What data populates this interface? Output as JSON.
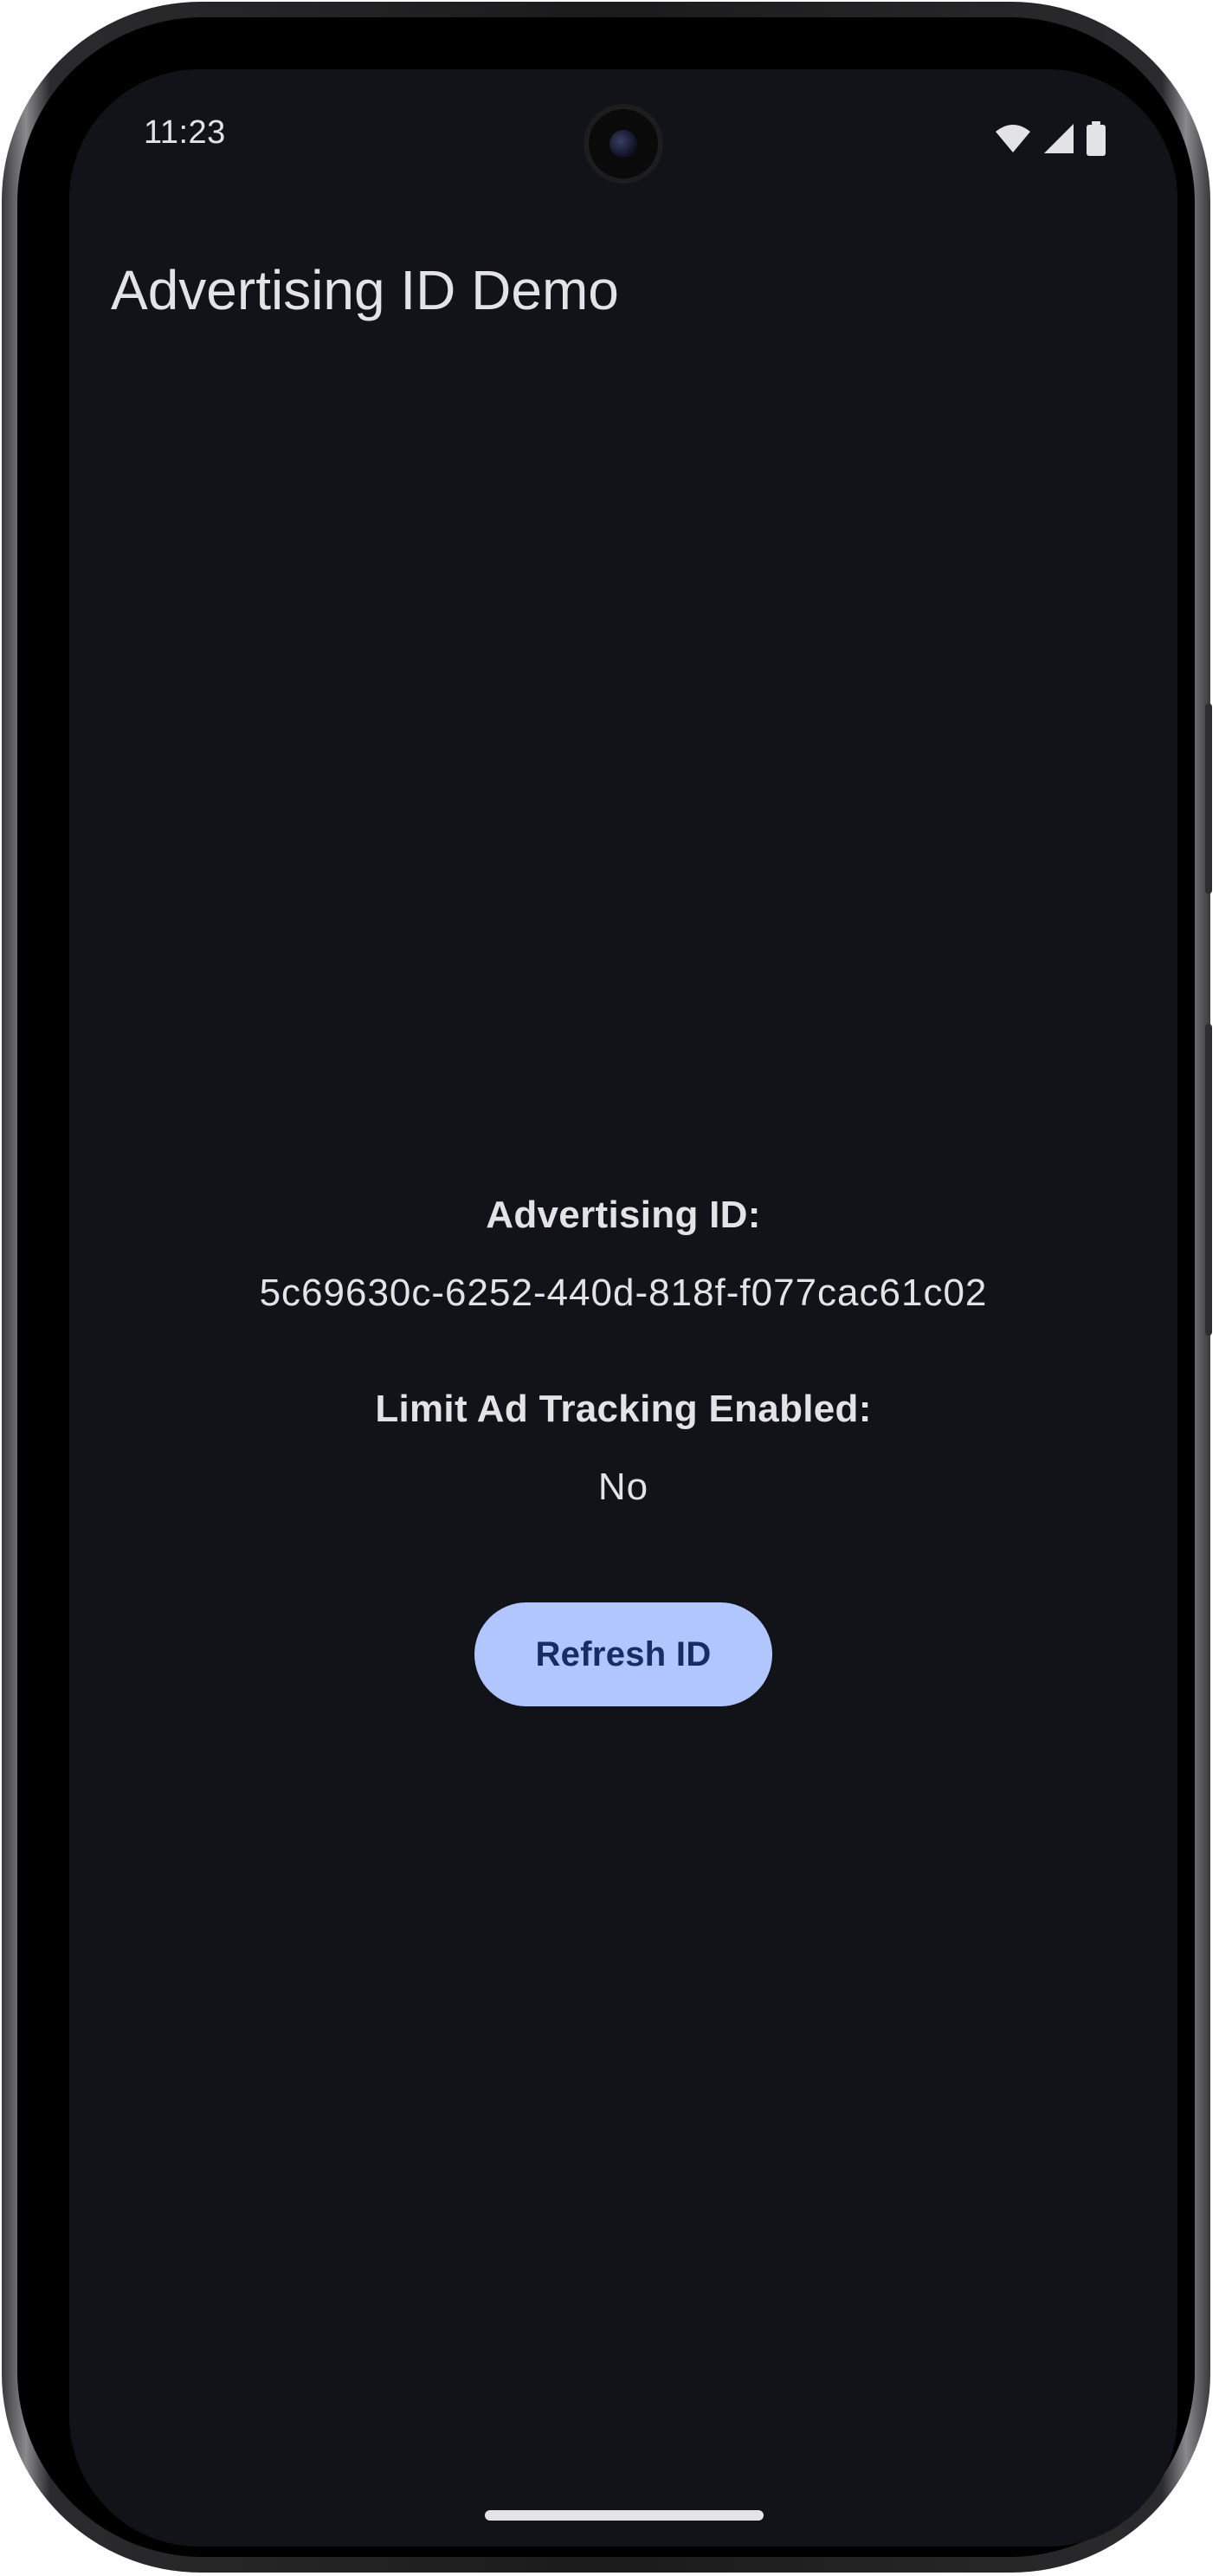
{
  "status_bar": {
    "time": "11:23",
    "icons": [
      "wifi-icon",
      "cellular-signal-icon",
      "battery-icon"
    ]
  },
  "app_bar": {
    "title": "Advertising ID Demo"
  },
  "main": {
    "advertising_id_label": "Advertising ID:",
    "advertising_id_value": "5c69630c-6252-440d-818f-f077cac61c02",
    "limit_ad_tracking_label": "Limit Ad Tracking Enabled:",
    "limit_ad_tracking_value": "No",
    "refresh_button_label": "Refresh ID"
  },
  "colors": {
    "background": "#121318",
    "text": "#e3e2e6",
    "button_background": "#b1c5ff",
    "button_text": "#172c60"
  }
}
